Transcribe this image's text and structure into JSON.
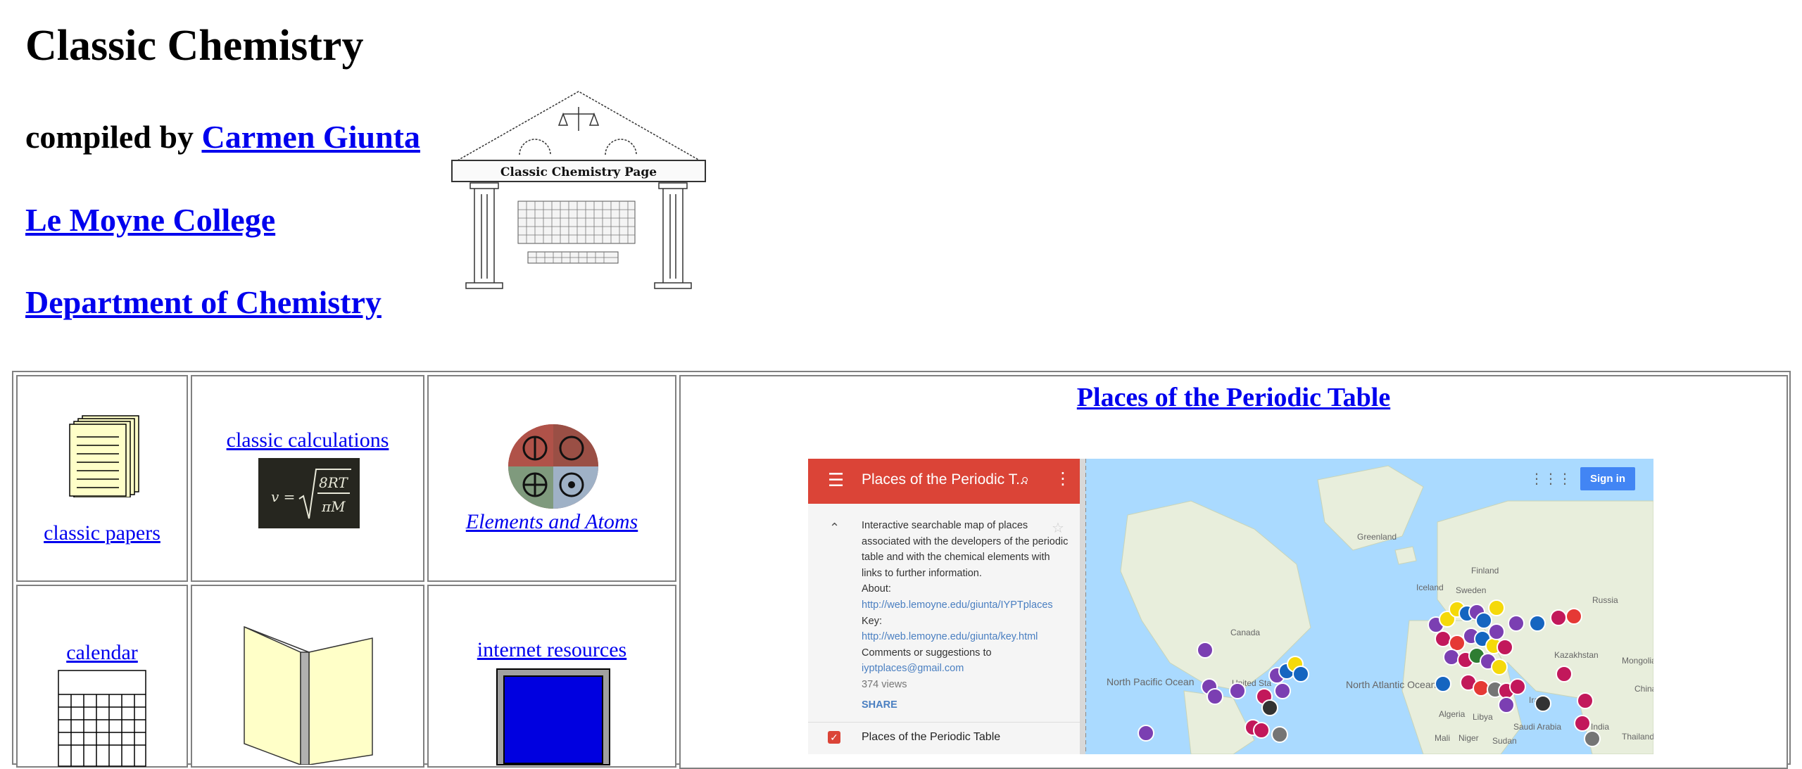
{
  "header": {
    "title": "Classic Chemistry",
    "compiled_by": "compiled by",
    "author": "Carmen Giunta",
    "college": "Le Moyne College",
    "department": "Department of Chemistry",
    "logo_text": "Classic Chemistry Page"
  },
  "grid": {
    "classic_papers": "classic papers",
    "classic_calculations": "classic calculations",
    "formula_v": "v =",
    "formula_num": "8RT",
    "formula_den": "πM",
    "elements_atoms": "Elements and Atoms",
    "calendar": "calendar",
    "internet_resources": "internet resources"
  },
  "ppt": {
    "title": "Places of the Periodic Table",
    "panel": {
      "title": "Places of the Periodic T...",
      "desc1": "Interactive searchable map of places associated with the developers of the periodic table and with the chemical elements with links to further information.",
      "about_label": "About:",
      "about_link": "http://web.lemoyne.edu/giunta/IYPTplaces",
      "key_label": "Key:",
      "key_link": "http://web.lemoyne.edu/giunta/key.html",
      "comments": "Comments or suggestions to",
      "email": "iyptplaces@gmail.com",
      "views": "374 views",
      "share": "SHARE",
      "layer": "Places of the Periodic Table"
    },
    "signin": "Sign in",
    "geo": {
      "greenland": "Greenland",
      "iceland": "Iceland",
      "finland": "Finland",
      "sweden": "Sweden",
      "russia": "Russia",
      "canada": "Canada",
      "kazakhstan": "Kazakhstan",
      "mongolia": "Mongolia",
      "china": "China",
      "north_pacific": "North Pacific Ocean",
      "north_atlantic": "North Atlantic Ocean",
      "united_states": "United Sta",
      "iraq": "Iraq",
      "saudi_arabia": "Saudi Arabia",
      "algeria": "Algeria",
      "libya": "Libya",
      "mali": "Mali",
      "niger": "Niger",
      "sudan": "Sudan",
      "india": "India",
      "thailand": "Thailand"
    }
  },
  "colors": {
    "link": "#0000ee",
    "map_header": "#db4437",
    "map_water": "#aadaff",
    "map_land": "#e8eedc",
    "signin": "#4285f4",
    "pin_purple": "#7b3fb2",
    "pin_magenta": "#c2185b",
    "pin_yellow": "#f5d90a",
    "pin_blue": "#1565c0",
    "pin_red": "#e53935",
    "pin_dark": "#333333",
    "pin_gray": "#757575"
  }
}
